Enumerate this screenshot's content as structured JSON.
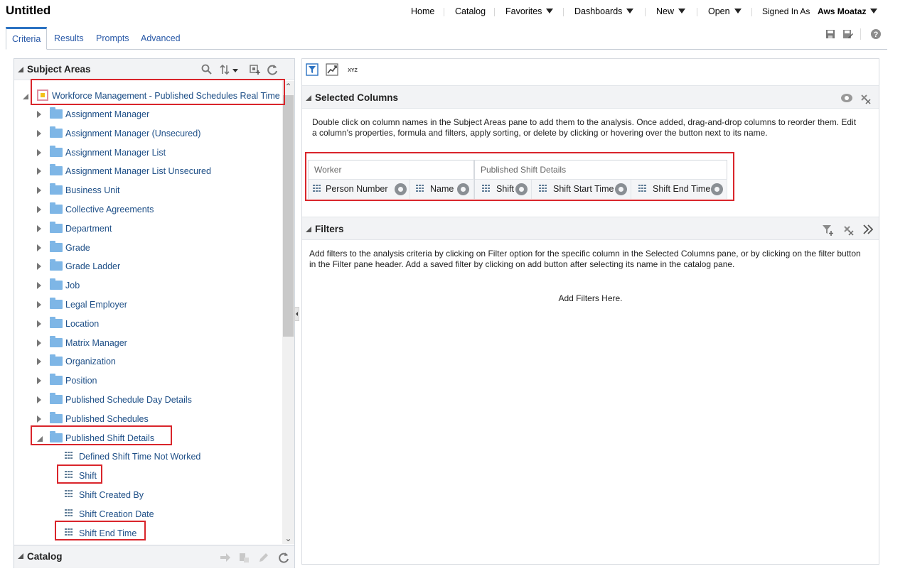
{
  "app": {
    "title": "Untitled"
  },
  "nav": {
    "home": "Home",
    "catalog": "Catalog",
    "favorites": "Favorites",
    "dashboards": "Dashboards",
    "new": "New",
    "open": "Open",
    "signed_in_as": "Signed In As",
    "user": "Aws Moataz"
  },
  "tabs": [
    "Criteria",
    "Results",
    "Prompts",
    "Advanced"
  ],
  "subject_areas": {
    "title": "Subject Areas",
    "root": "Workforce Management - Published Schedules Real Time",
    "folders": [
      "Assignment Manager",
      "Assignment Manager (Unsecured)",
      "Assignment Manager List",
      "Assignment Manager List Unsecured",
      "Business Unit",
      "Collective Agreements",
      "Department",
      "Grade",
      "Grade Ladder",
      "Job",
      "Legal Employer",
      "Location",
      "Matrix Manager",
      "Organization",
      "Position",
      "Published Schedule Day Details",
      "Published Schedules",
      "Published Shift Details"
    ],
    "expanded_columns": [
      "Defined Shift Time Not Worked",
      "Shift",
      "Shift Created By",
      "Shift Creation Date",
      "Shift End Time"
    ]
  },
  "catalog": {
    "title": "Catalog"
  },
  "selected_columns": {
    "title": "Selected Columns",
    "description_line1": "Double click on column names in the Subject Areas pane to add them to the analysis. Once added, drag-and-drop columns to reorder them. Edit",
    "description_line2": "a column's properties, formula and filters, apply sorting, or delete by clicking or hovering over the button next to its name.",
    "groups": [
      {
        "name": "Worker",
        "columns": [
          "Person Number",
          "Name"
        ]
      },
      {
        "name": "Published Shift Details",
        "columns": [
          "Shift",
          "Shift Start Time",
          "Shift End Time"
        ]
      }
    ]
  },
  "filters": {
    "title": "Filters",
    "description_line1": "Add filters to the analysis criteria by clicking on Filter option for the specific column in the Selected Columns pane, or by clicking on the filter button",
    "description_line2": "in the Filter pane header. Add a saved filter by clicking on add button after selecting its name in the catalog pane.",
    "placeholder": "Add Filters Here."
  },
  "colors": {
    "accent": "#2b72c2",
    "link": "#1e4f87",
    "highlight": "#d9252b",
    "folder": "#7eb6e6"
  }
}
